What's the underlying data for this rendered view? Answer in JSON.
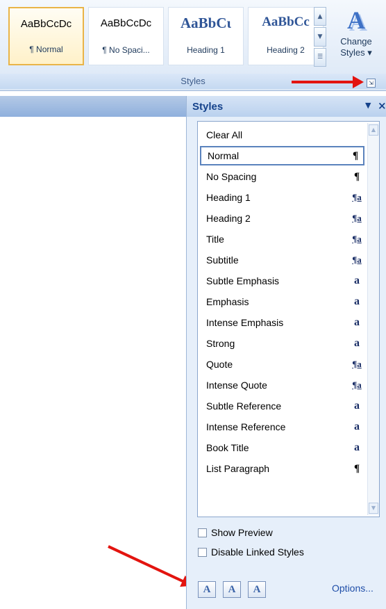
{
  "ribbon": {
    "gallery": [
      {
        "sample": "AaBbCcDc",
        "label": "¶ Normal",
        "selected": true,
        "kind": "body"
      },
      {
        "sample": "AaBbCcDc",
        "label": "¶ No Spaci...",
        "selected": false,
        "kind": "body"
      },
      {
        "sample": "AaBbCɩ",
        "label": "Heading 1",
        "selected": false,
        "kind": "heading"
      },
      {
        "sample": "AaBbCc",
        "label": "Heading 2",
        "selected": false,
        "kind": "heading"
      }
    ],
    "change_styles": {
      "icon": "A",
      "label_line1": "Change",
      "label_line2": "Styles ▾"
    },
    "group_label": "Styles",
    "dialog_launcher_icon": "dialog-launcher-icon"
  },
  "pane": {
    "title": "Styles",
    "menu_glyph": "▼",
    "close_glyph": "×",
    "items": [
      {
        "name": "Clear All",
        "indicator": ""
      },
      {
        "name": "Normal",
        "indicator": "¶",
        "type": "para",
        "selected": true
      },
      {
        "name": "No Spacing",
        "indicator": "¶",
        "type": "para"
      },
      {
        "name": "Heading 1",
        "indicator": "¶a",
        "type": "link"
      },
      {
        "name": "Heading 2",
        "indicator": "¶a",
        "type": "link"
      },
      {
        "name": "Title",
        "indicator": "¶a",
        "type": "link"
      },
      {
        "name": "Subtitle",
        "indicator": "¶a",
        "type": "link"
      },
      {
        "name": "Subtle Emphasis",
        "indicator": "a",
        "type": "char"
      },
      {
        "name": "Emphasis",
        "indicator": "a",
        "type": "char"
      },
      {
        "name": "Intense Emphasis",
        "indicator": "a",
        "type": "char"
      },
      {
        "name": "Strong",
        "indicator": "a",
        "type": "char"
      },
      {
        "name": "Quote",
        "indicator": "¶a",
        "type": "link"
      },
      {
        "name": "Intense Quote",
        "indicator": "¶a",
        "type": "link"
      },
      {
        "name": "Subtle Reference",
        "indicator": "a",
        "type": "char"
      },
      {
        "name": "Intense Reference",
        "indicator": "a",
        "type": "char"
      },
      {
        "name": "Book Title",
        "indicator": "a",
        "type": "char"
      },
      {
        "name": "List Paragraph",
        "indicator": "¶",
        "type": "para"
      }
    ],
    "show_preview": {
      "label": "Show Preview",
      "checked": false
    },
    "disable_linked": {
      "label": "Disable Linked Styles",
      "checked": false
    },
    "buttons": [
      {
        "name": "new-style-button",
        "glyph": "A"
      },
      {
        "name": "style-inspector-button",
        "glyph": "A"
      },
      {
        "name": "manage-styles-button",
        "glyph": "A"
      }
    ],
    "options_label": "Options..."
  },
  "colors": {
    "arrow": "#e3140f",
    "ribbon_text": "#1e395b",
    "pane_title": "#15428b"
  }
}
